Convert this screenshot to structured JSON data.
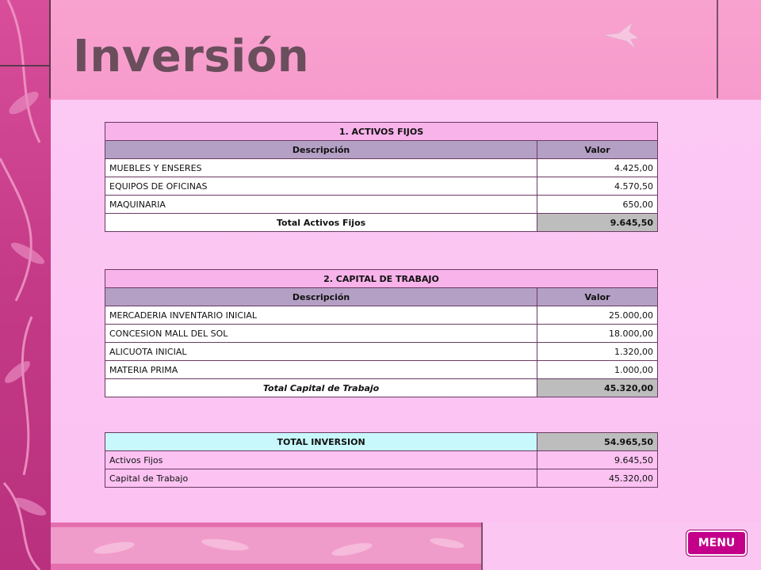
{
  "title": "Inversión",
  "sections": {
    "activos": {
      "heading": "1. ACTIVOS FIJOS",
      "col_desc": "Descripción",
      "col_valor": "Valor",
      "rows": [
        {
          "desc": "MUEBLES Y ENSERES",
          "valor": "4.425,00"
        },
        {
          "desc": "EQUIPOS DE OFICINAS",
          "valor": "4.570,50"
        },
        {
          "desc": "MAQUINARIA",
          "valor": "650,00"
        }
      ],
      "total_label": "Total Activos Fijos",
      "total_valor": "9.645,50"
    },
    "capital": {
      "heading": "2. CAPITAL DE TRABAJO",
      "col_desc": "Descripción",
      "col_valor": "Valor",
      "rows": [
        {
          "desc": "MERCADERIA INVENTARIO INICIAL",
          "valor": "25.000,00"
        },
        {
          "desc": "CONCESION MALL DEL SOL",
          "valor": "18.000,00"
        },
        {
          "desc": "ALICUOTA  INICIAL",
          "valor": "1.320,00"
        },
        {
          "desc": "MATERIA PRIMA",
          "valor": "1.000,00"
        }
      ],
      "total_label": "Total Capital de Trabajo",
      "total_valor": "45.320,00"
    },
    "inversion": {
      "heading": "TOTAL INVERSION",
      "heading_valor": "54.965,50",
      "rows": [
        {
          "desc": "Activos Fijos",
          "valor": "9.645,50"
        },
        {
          "desc": "Capital de Trabajo",
          "valor": "45.320,00"
        }
      ]
    }
  },
  "menu_label": "MENU",
  "colors": {
    "background": "#fbc6f2",
    "header": "#f8a2cf",
    "strip": "#c43a86",
    "menu": "#c4008a"
  },
  "icons": {
    "bird": "hummingbird-icon"
  }
}
